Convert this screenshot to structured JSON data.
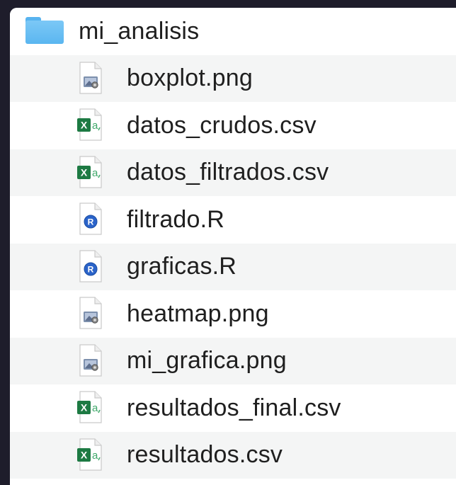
{
  "folder": {
    "name": "mi_analisis",
    "icon": "folder-icon"
  },
  "files": [
    {
      "name": "boxplot.png",
      "type": "image",
      "icon": "image-file-icon"
    },
    {
      "name": "datos_crudos.csv",
      "type": "csv",
      "icon": "excel-csv-icon"
    },
    {
      "name": "datos_filtrados.csv",
      "type": "csv",
      "icon": "excel-csv-icon"
    },
    {
      "name": "filtrado.R",
      "type": "r",
      "icon": "r-script-icon"
    },
    {
      "name": "graficas.R",
      "type": "r",
      "icon": "r-script-icon"
    },
    {
      "name": "heatmap.png",
      "type": "image",
      "icon": "image-file-icon"
    },
    {
      "name": "mi_grafica.png",
      "type": "image",
      "icon": "image-file-icon"
    },
    {
      "name": "resultados_final.csv",
      "type": "csv",
      "icon": "excel-csv-icon"
    },
    {
      "name": "resultados.csv",
      "type": "csv",
      "icon": "excel-csv-icon"
    }
  ],
  "colors": {
    "folder": "#5ab6f0",
    "excel": "#1d7a43",
    "r_blue": "#2a63c9",
    "stripe": "#f4f5f5",
    "background": "#1e1d2b"
  }
}
